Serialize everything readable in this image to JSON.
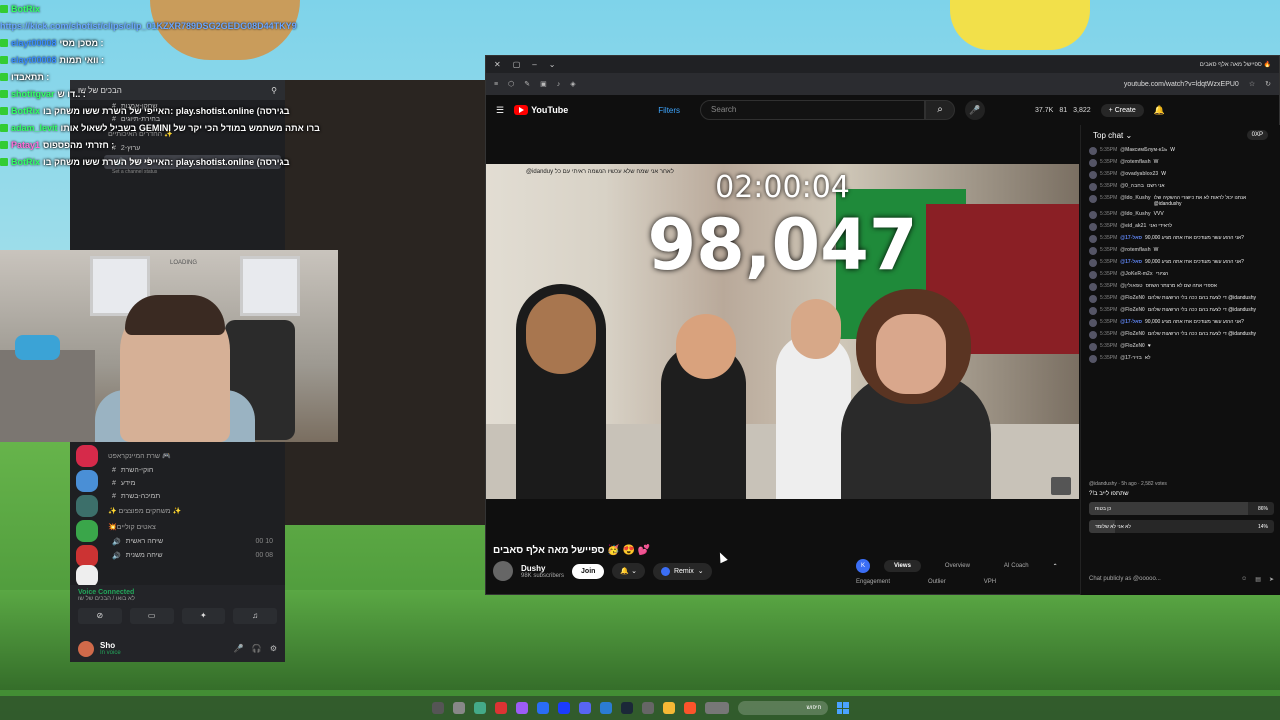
{
  "overlay_chat": [
    {
      "user": "BotRix",
      "user_color": "green",
      "msg": ""
    },
    {
      "user": "",
      "user_color": "blue",
      "msg": "",
      "link": "https://kick.com/shotist/clips/clip_01KZXR789DSG2GEDG08D44TKY9"
    },
    {
      "user": "elayt00008",
      "user_color": "blue",
      "msg": "מסכן מסי :"
    },
    {
      "user": "elayt00008",
      "user_color": "blue",
      "msg": "וואי תמות :"
    },
    {
      "user": "",
      "user_color": "green",
      "msg": "תתאבדו :"
    },
    {
      "user": "shotitgvar",
      "user_color": "green",
      "msg": "דו ש.. :"
    },
    {
      "user": "BotRix",
      "user_color": "green",
      "msg": "האייפי של השרת ששו משחק בו: play.shotist.online (בגירסה"
    },
    {
      "user": "adam_levit",
      "user_color": "green",
      "msg": "בשביל לשאול אותו GEMINI ברו אתה משתמש במודל הכי יקר של"
    },
    {
      "user": "Patay1",
      "user_color": "pink",
      "msg": "חזרתי מהפספוס :"
    },
    {
      "user": "BotRix",
      "user_color": "green",
      "msg": "האייפי של השרת ששו משחק בו: play.shotist.online (בגירסה"
    }
  ],
  "discord": {
    "server_name": "הבכים של שו",
    "categories": [
      "החדרים האיכותיים ✨",
      "שרת המיינקראפט 🎮",
      "✨ משחקים מפוצצים ✨",
      "💥צאטים קוליים"
    ],
    "channels": [
      "שחקן-אמנות",
      "בחירת-תיוגים",
      "ערוץ-2",
      "חוקי-השרת",
      "מידע",
      "תמיכה-בשרת",
      "שיחה ראשית",
      "שיחה משנית"
    ],
    "active_channel": "לא בואו",
    "active_status": "Set a channel status",
    "voice_status": "Voice Connected",
    "voice_channel": "לא בואו / הבכים של שו",
    "user_name": "Sho",
    "user_status": "In voice",
    "voice_counts": [
      "00 10",
      "00 08"
    ]
  },
  "webcam": {
    "sign_text": "LOADING"
  },
  "browser": {
    "tab_title": "ספיישל מאה אלף סאבים 🔥",
    "url": "youtube.com/watch?v=ldqtWzxEPU0",
    "search_placeholder": "Search",
    "filters_label": "Filters",
    "logo_text": "YouTube",
    "stats": [
      "37.7K",
      "81",
      "3,822"
    ],
    "create_label": "Create"
  },
  "player": {
    "timer": "02:00:04",
    "count": "98,047",
    "caption": "@idanduy לאחר אני שמח שלא עכשיו הנשמה ראיתי עם כל"
  },
  "video": {
    "title": "ספיישל מאה אלף סאבים 🥳 😍 💕",
    "channel": "Dushy",
    "subscribers": "98K subscribers",
    "join_label": "Join",
    "remix_label": "Remix"
  },
  "analytics": {
    "tabs": [
      "Views",
      "Overview",
      "AI Coach"
    ],
    "active_tab": "Views",
    "labels": [
      "Engagement",
      "Outlier",
      "VPH"
    ]
  },
  "live_chat": {
    "mode": "Top chat",
    "xp": "0XP",
    "messages": [
      {
        "time": "5:35PM",
        "author": "@МаксимБлум-к1ь",
        "text": "W",
        "mod": false
      },
      {
        "time": "5:35PM",
        "author": "@rotemflash",
        "text": "W",
        "mod": false
      },
      {
        "time": "5:35PM",
        "author": "@ovadyablox23",
        "text": "W",
        "mod": false
      },
      {
        "time": "5:35PM",
        "author": "@בחבה_0",
        "text": "אני רשם",
        "mod": false
      },
      {
        "time": "5:35PM",
        "author": "@Ido_Kushy",
        "text": "אנחנו יכול לראות לא את כישורי ההשקיה שלו @idandushy",
        "mod": false
      },
      {
        "time": "5:35PM",
        "author": "@Ido_Kushy",
        "text": "VVV",
        "mod": false
      },
      {
        "time": "5:35PM",
        "author": "@eid_ak21",
        "text": "לראידי ואני",
        "mod": false
      },
      {
        "time": "5:35PM",
        "author": "@סאל-17",
        "text": "אני הרגע עשר מעודכים אחז אתה מגיע 90,000?",
        "mod": true
      },
      {
        "time": "5:35PM",
        "author": "@rotemflash",
        "text": "W",
        "mod": false
      },
      {
        "time": "5:35PM",
        "author": "@סאל-17",
        "text": "אני הרגע עשר מעודכים אחז אתה מגיע 90,000?",
        "mod": true
      },
      {
        "time": "5:35PM",
        "author": "@JoKeR-m2x",
        "text": "הציורי",
        "mod": false
      },
      {
        "time": "5:35PM",
        "author": "@טפאולין",
        "text": "אספרי אתה שם לא מרצתר השחס",
        "mod": false
      },
      {
        "time": "5:35PM",
        "author": "@FloZeN0",
        "text": "די לצעת בהם ככה בלי הרשעות שלהם @idandushy",
        "mod": false
      },
      {
        "time": "5:35PM",
        "author": "@FloZeN0",
        "text": "די לצעת בהם ככה בלי הרשעות שלהם @idandushy",
        "mod": false
      },
      {
        "time": "5:35PM",
        "author": "@סאל-17",
        "text": "אני הרגע עשר מעודכים אחז אתה מגיע 90,000?",
        "mod": true
      },
      {
        "time": "5:35PM",
        "author": "@FloZeN0",
        "text": "די לצעת בהם ככה בלי הרשעות שלהם @idandushy",
        "mod": false
      },
      {
        "time": "5:35PM",
        "author": "@FloZeN0",
        "text": "♥",
        "mod": false
      },
      {
        "time": "5:35PM",
        "author": "@בזיר-17",
        "text": "לא",
        "mod": false
      }
    ],
    "poll": {
      "header": "@idandushy · 5h ago · 2,582 votes",
      "question": "?!שתתפו לייב ב",
      "options": [
        {
          "label": "כן בטוח",
          "percent": 86
        },
        {
          "label": "לא אני לא שלומד",
          "percent": 14
        }
      ]
    },
    "input_placeholder": "Chat publicly as @ooooo..."
  },
  "taskbar": {
    "search_placeholder": "חיפוש"
  },
  "colors": {
    "yt_red": "#ff0000",
    "accent_blue": "#3ea6ff",
    "discord_bg": "#1e1f22",
    "discord_green": "#23a55a"
  }
}
